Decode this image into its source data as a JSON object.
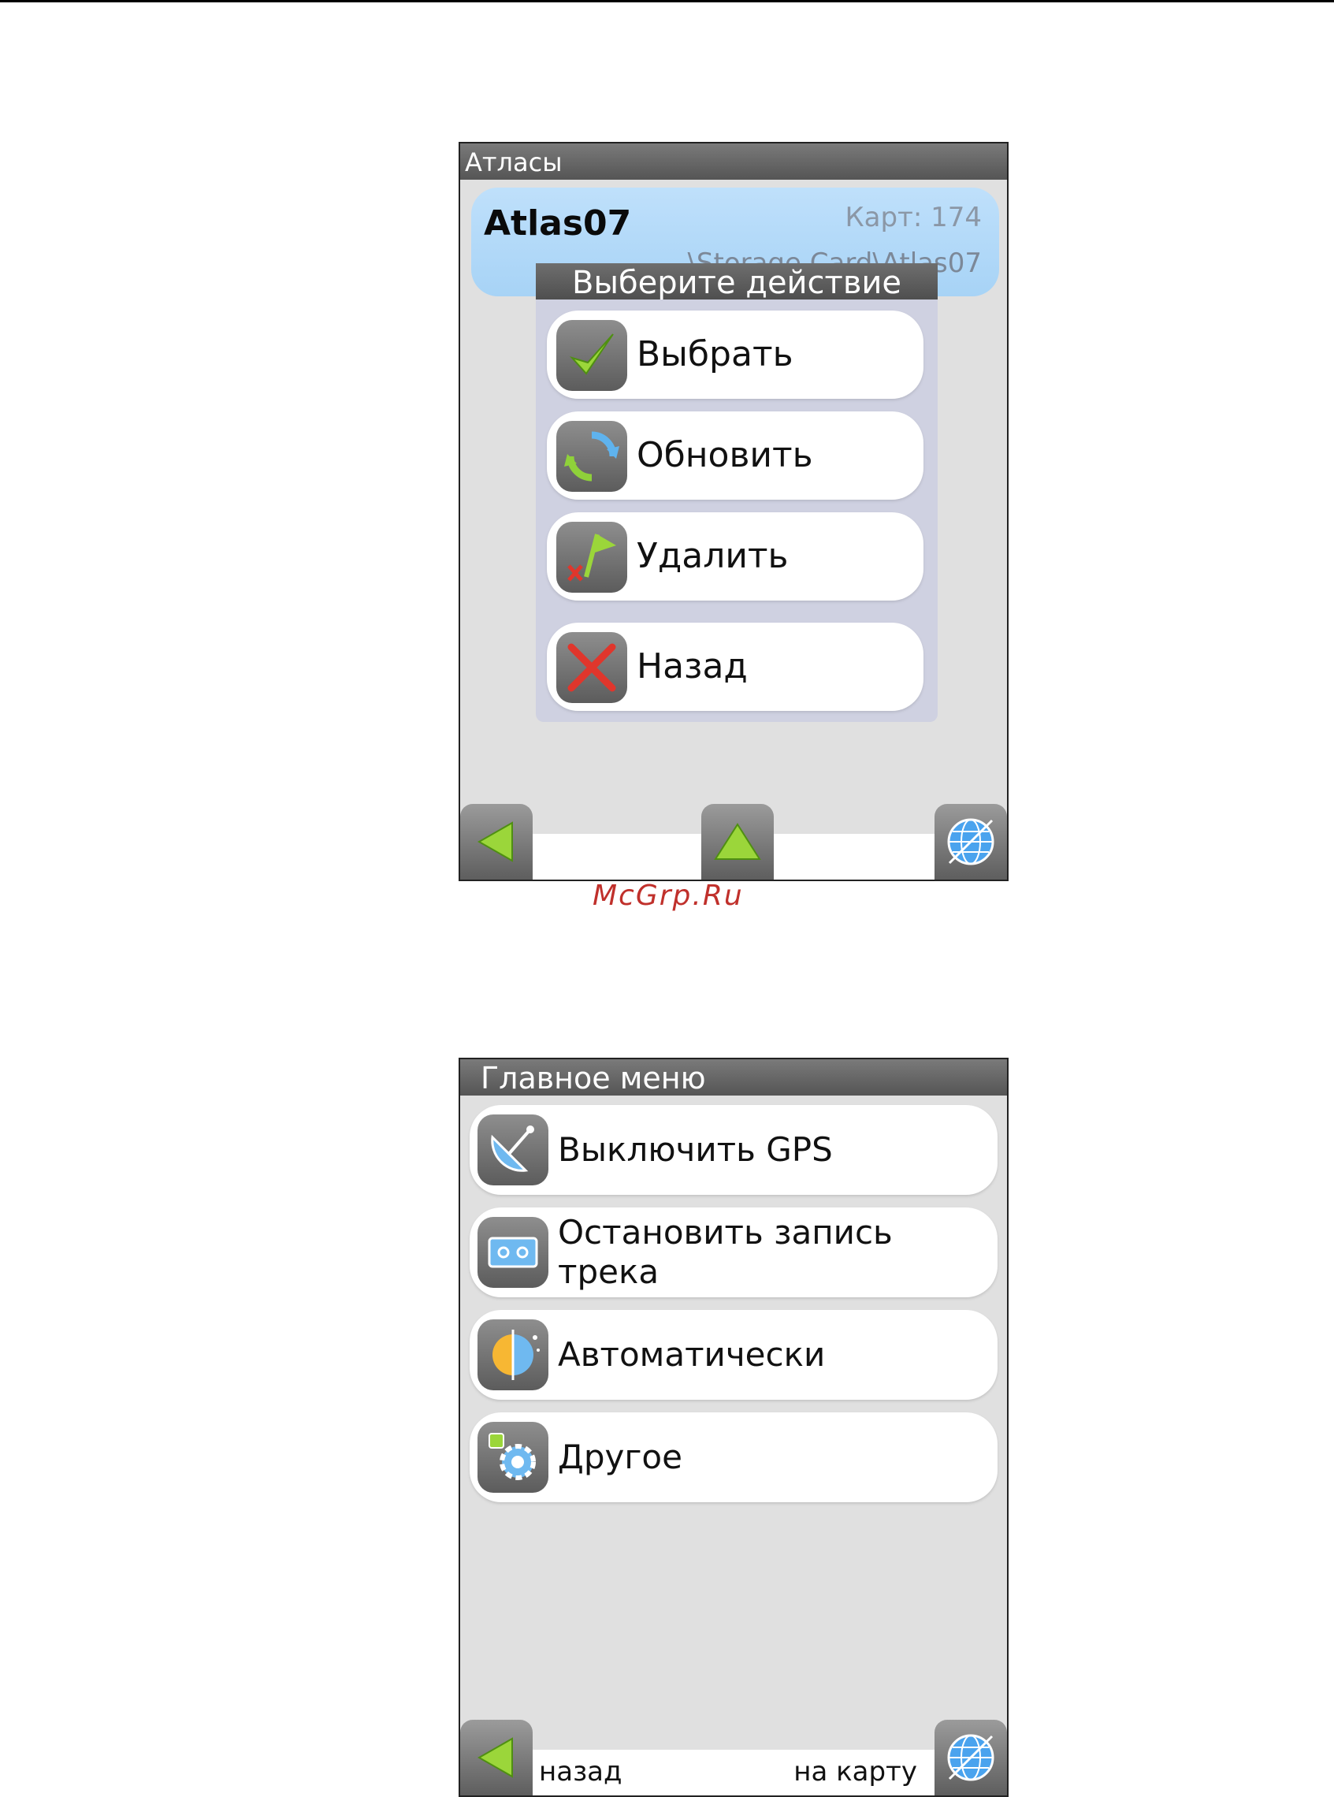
{
  "atlases_screen": {
    "title": "Атласы",
    "atlas": {
      "name": "Atlas07",
      "count": "Карт: 174",
      "path": "\\Storage Card\\Atlas07"
    },
    "dialog": {
      "title": "Выберите действие",
      "actions": [
        {
          "label": "Выбрать",
          "icon": "checkmark-icon"
        },
        {
          "label": "Обновить",
          "icon": "refresh-icon"
        },
        {
          "label": "Удалить",
          "icon": "delete-flag-icon"
        },
        {
          "label": "Назад",
          "icon": "close-icon"
        }
      ]
    },
    "nav": {
      "back_icon": "back-arrow-icon",
      "up_icon": "up-arrow-icon",
      "map_icon": "globe-icon"
    }
  },
  "watermark": "McGrp.Ru",
  "main_menu_screen": {
    "title": "Главное меню",
    "items": [
      {
        "label": "Выключить GPS",
        "icon": "satellite-dish-icon"
      },
      {
        "label": "Остановить запись трека",
        "icon": "tape-record-icon"
      },
      {
        "label": "Автоматически",
        "icon": "day-night-icon"
      },
      {
        "label": "Другое",
        "icon": "gear-icon"
      }
    ],
    "nav": {
      "back_label": "назад",
      "map_label": "на карту"
    }
  },
  "colors": {
    "accent_blue": "#a7d3f6",
    "title_bar": "#555555",
    "watermark": "#c0302b"
  }
}
